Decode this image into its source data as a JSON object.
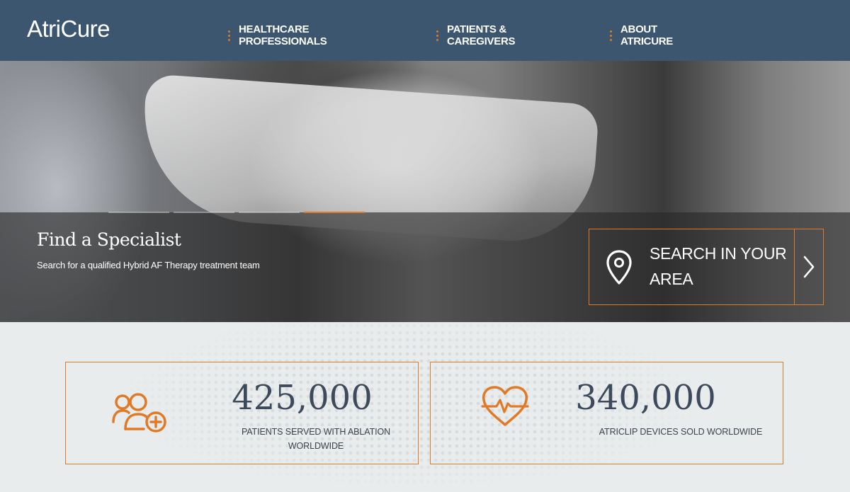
{
  "header": {
    "logo_text": "AtriCure",
    "nav": [
      {
        "label": "HEALTHCARE PROFESSIONALS"
      },
      {
        "label": "PATIENTS & CAREGIVERS"
      },
      {
        "label": "ABOUT ATRICURE"
      }
    ],
    "accent_color": "#e07a26",
    "background_color": "#3c566f"
  },
  "hero": {
    "slide_indicators": 4,
    "active_slide": 4,
    "title": "Find a Specialist",
    "subtitle": "Search for a qualified Hybrid AF Therapy treatment team",
    "search_cta": {
      "label": "SEARCH IN YOUR AREA",
      "icon": "map-pin-icon",
      "arrow_icon": "chevron-right-icon"
    }
  },
  "stats": [
    {
      "icon": "patients-add-icon",
      "number": "425,000",
      "label": "PATIENTS SERVED WITH ABLATION WORLDWIDE"
    },
    {
      "icon": "heart-pulse-icon",
      "number": "340,000",
      "label": "ATRICLIP DEVICES SOLD WORLDWIDE"
    }
  ]
}
